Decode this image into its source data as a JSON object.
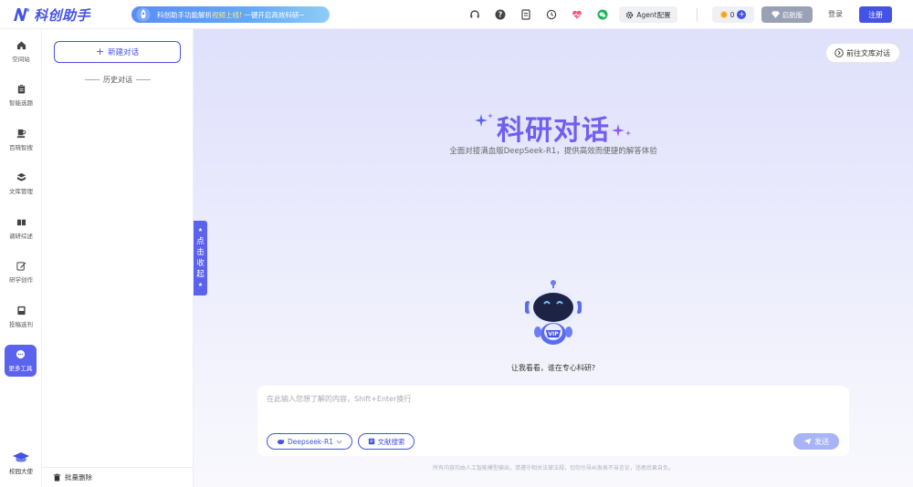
{
  "header": {
    "app_name": "科创助手",
    "promo_text_a": "科创助手功能解析",
    "promo_text_b": "视频上线!",
    "promo_text_c": "一键开启高效科研~",
    "agent_label": "Agent配置",
    "coins": "0",
    "version_label": "启航版",
    "login_label": "登录",
    "register_label": "注册",
    "icons": [
      "headset-icon",
      "help-icon",
      "document-icon",
      "history-icon",
      "heart-pulse-icon",
      "wechat-icon"
    ]
  },
  "nav": {
    "items": [
      {
        "label": "空间站",
        "icon": "home-icon"
      },
      {
        "label": "智能选题",
        "icon": "clipboard-icon"
      },
      {
        "label": "百晓智搜",
        "icon": "book-search-icon"
      },
      {
        "label": "文库管理",
        "icon": "library-icon"
      },
      {
        "label": "调研综述",
        "icon": "reading-icon"
      },
      {
        "label": "研学创作",
        "icon": "edit-icon"
      },
      {
        "label": "投稿选刊",
        "icon": "journal-icon"
      },
      {
        "label": "更多工具",
        "icon": "more-tools-icon"
      }
    ],
    "active_index": 7,
    "bottom_label": "校园大使"
  },
  "history": {
    "new_chat_label": "新建对话",
    "title": "历史对话",
    "bulk_delete_label": "批量删除"
  },
  "collapse_tab": {
    "chars": [
      "点",
      "击",
      "收",
      "起"
    ]
  },
  "main": {
    "to_library_label": "前往文库对话",
    "hero_title": "科研对话",
    "hero_subtitle": "全面对接满血版DeepSeek-R1，提供高效而便捷的解答体验",
    "robot_caption": "让我看看，谁在专心科研?",
    "input_placeholder": "在此输入您想了解的内容，Shift+Enter换行",
    "model_label": "Deepseek-R1",
    "literature_search_label": "文献搜索",
    "send_label": "发送",
    "disclaimer": "所有内容均由人工智能模型输出，请遵守相关法律法规，切勿引导AI发表不当言论，违者后果自负。"
  },
  "colors": {
    "accent": "#4452e6",
    "active_nav": "#5b63ee",
    "promo_gradient_start": "#5b8df6",
    "send_disabled": "#a8b4f5"
  }
}
